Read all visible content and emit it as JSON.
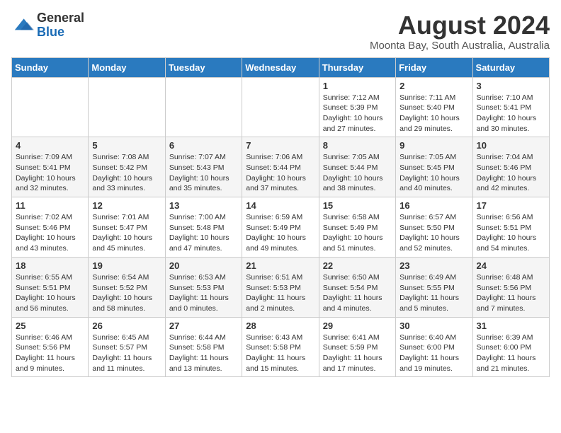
{
  "header": {
    "logo_general": "General",
    "logo_blue": "Blue",
    "month_year": "August 2024",
    "location": "Moonta Bay, South Australia, Australia"
  },
  "days_of_week": [
    "Sunday",
    "Monday",
    "Tuesday",
    "Wednesday",
    "Thursday",
    "Friday",
    "Saturday"
  ],
  "weeks": [
    [
      {
        "day": "",
        "info": ""
      },
      {
        "day": "",
        "info": ""
      },
      {
        "day": "",
        "info": ""
      },
      {
        "day": "",
        "info": ""
      },
      {
        "day": "1",
        "info": "Sunrise: 7:12 AM\nSunset: 5:39 PM\nDaylight: 10 hours\nand 27 minutes."
      },
      {
        "day": "2",
        "info": "Sunrise: 7:11 AM\nSunset: 5:40 PM\nDaylight: 10 hours\nand 29 minutes."
      },
      {
        "day": "3",
        "info": "Sunrise: 7:10 AM\nSunset: 5:41 PM\nDaylight: 10 hours\nand 30 minutes."
      }
    ],
    [
      {
        "day": "4",
        "info": "Sunrise: 7:09 AM\nSunset: 5:41 PM\nDaylight: 10 hours\nand 32 minutes."
      },
      {
        "day": "5",
        "info": "Sunrise: 7:08 AM\nSunset: 5:42 PM\nDaylight: 10 hours\nand 33 minutes."
      },
      {
        "day": "6",
        "info": "Sunrise: 7:07 AM\nSunset: 5:43 PM\nDaylight: 10 hours\nand 35 minutes."
      },
      {
        "day": "7",
        "info": "Sunrise: 7:06 AM\nSunset: 5:44 PM\nDaylight: 10 hours\nand 37 minutes."
      },
      {
        "day": "8",
        "info": "Sunrise: 7:05 AM\nSunset: 5:44 PM\nDaylight: 10 hours\nand 38 minutes."
      },
      {
        "day": "9",
        "info": "Sunrise: 7:05 AM\nSunset: 5:45 PM\nDaylight: 10 hours\nand 40 minutes."
      },
      {
        "day": "10",
        "info": "Sunrise: 7:04 AM\nSunset: 5:46 PM\nDaylight: 10 hours\nand 42 minutes."
      }
    ],
    [
      {
        "day": "11",
        "info": "Sunrise: 7:02 AM\nSunset: 5:46 PM\nDaylight: 10 hours\nand 43 minutes."
      },
      {
        "day": "12",
        "info": "Sunrise: 7:01 AM\nSunset: 5:47 PM\nDaylight: 10 hours\nand 45 minutes."
      },
      {
        "day": "13",
        "info": "Sunrise: 7:00 AM\nSunset: 5:48 PM\nDaylight: 10 hours\nand 47 minutes."
      },
      {
        "day": "14",
        "info": "Sunrise: 6:59 AM\nSunset: 5:49 PM\nDaylight: 10 hours\nand 49 minutes."
      },
      {
        "day": "15",
        "info": "Sunrise: 6:58 AM\nSunset: 5:49 PM\nDaylight: 10 hours\nand 51 minutes."
      },
      {
        "day": "16",
        "info": "Sunrise: 6:57 AM\nSunset: 5:50 PM\nDaylight: 10 hours\nand 52 minutes."
      },
      {
        "day": "17",
        "info": "Sunrise: 6:56 AM\nSunset: 5:51 PM\nDaylight: 10 hours\nand 54 minutes."
      }
    ],
    [
      {
        "day": "18",
        "info": "Sunrise: 6:55 AM\nSunset: 5:51 PM\nDaylight: 10 hours\nand 56 minutes."
      },
      {
        "day": "19",
        "info": "Sunrise: 6:54 AM\nSunset: 5:52 PM\nDaylight: 10 hours\nand 58 minutes."
      },
      {
        "day": "20",
        "info": "Sunrise: 6:53 AM\nSunset: 5:53 PM\nDaylight: 11 hours\nand 0 minutes."
      },
      {
        "day": "21",
        "info": "Sunrise: 6:51 AM\nSunset: 5:53 PM\nDaylight: 11 hours\nand 2 minutes."
      },
      {
        "day": "22",
        "info": "Sunrise: 6:50 AM\nSunset: 5:54 PM\nDaylight: 11 hours\nand 4 minutes."
      },
      {
        "day": "23",
        "info": "Sunrise: 6:49 AM\nSunset: 5:55 PM\nDaylight: 11 hours\nand 5 minutes."
      },
      {
        "day": "24",
        "info": "Sunrise: 6:48 AM\nSunset: 5:56 PM\nDaylight: 11 hours\nand 7 minutes."
      }
    ],
    [
      {
        "day": "25",
        "info": "Sunrise: 6:46 AM\nSunset: 5:56 PM\nDaylight: 11 hours\nand 9 minutes."
      },
      {
        "day": "26",
        "info": "Sunrise: 6:45 AM\nSunset: 5:57 PM\nDaylight: 11 hours\nand 11 minutes."
      },
      {
        "day": "27",
        "info": "Sunrise: 6:44 AM\nSunset: 5:58 PM\nDaylight: 11 hours\nand 13 minutes."
      },
      {
        "day": "28",
        "info": "Sunrise: 6:43 AM\nSunset: 5:58 PM\nDaylight: 11 hours\nand 15 minutes."
      },
      {
        "day": "29",
        "info": "Sunrise: 6:41 AM\nSunset: 5:59 PM\nDaylight: 11 hours\nand 17 minutes."
      },
      {
        "day": "30",
        "info": "Sunrise: 6:40 AM\nSunset: 6:00 PM\nDaylight: 11 hours\nand 19 minutes."
      },
      {
        "day": "31",
        "info": "Sunrise: 6:39 AM\nSunset: 6:00 PM\nDaylight: 11 hours\nand 21 minutes."
      }
    ]
  ]
}
